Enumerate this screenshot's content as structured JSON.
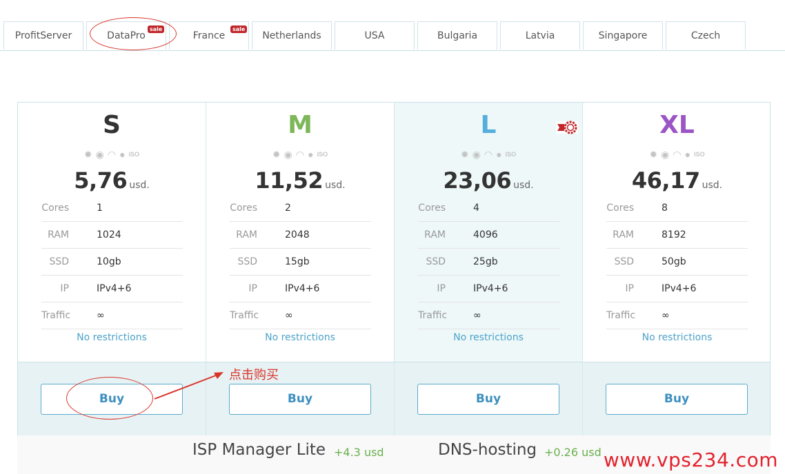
{
  "tabs": [
    {
      "label": "ProfitServer",
      "badge": ""
    },
    {
      "label": "DataPro",
      "badge": "sale"
    },
    {
      "label": "France",
      "badge": "sale"
    },
    {
      "label": "Netherlands",
      "badge": ""
    },
    {
      "label": "USA",
      "badge": ""
    },
    {
      "label": "Bulgaria",
      "badge": ""
    },
    {
      "label": "Latvia",
      "badge": ""
    },
    {
      "label": "Singapore",
      "badge": ""
    },
    {
      "label": "Czech",
      "badge": ""
    }
  ],
  "plans": [
    {
      "name": "S",
      "color": "#333333",
      "price": "5,76",
      "currency": "usd.",
      "cores": "1",
      "ram": "1024",
      "ssd": "10gb",
      "ip": "IPv4+6",
      "traffic": "∞",
      "note": "No restrictions",
      "buy": "Buy"
    },
    {
      "name": "M",
      "color": "#7db75a",
      "price": "11,52",
      "currency": "usd.",
      "cores": "2",
      "ram": "2048",
      "ssd": "15gb",
      "ip": "IPv4+6",
      "traffic": "∞",
      "note": "No restrictions",
      "buy": "Buy"
    },
    {
      "name": "L",
      "color": "#55aedb",
      "price": "23,06",
      "currency": "usd.",
      "cores": "4",
      "ram": "4096",
      "ssd": "25gb",
      "ip": "IPv4+6",
      "traffic": "∞",
      "note": "No restrictions",
      "buy": "Buy"
    },
    {
      "name": "XL",
      "color": "#9b55c5",
      "price": "46,17",
      "currency": "usd.",
      "cores": "8",
      "ram": "8192",
      "ssd": "50gb",
      "ip": "IPv4+6",
      "traffic": "∞",
      "note": "No restrictions",
      "buy": "Buy"
    }
  ],
  "spec_labels": {
    "cores": "Cores",
    "ram": "RAM",
    "ssd": "SSD",
    "ip": "IP",
    "traffic": "Traffic"
  },
  "os_icon_names": [
    "gear-icon",
    "ubuntu-icon",
    "debian-icon",
    "freebsd-icon",
    "iso-icon"
  ],
  "iso_label": "ISO",
  "addons": [
    {
      "name": "ISP Manager Lite",
      "price": "+4.3 usd"
    },
    {
      "name": "DNS-hosting",
      "price": "+0.26 usd"
    }
  ],
  "annotation_text": "点击购买",
  "watermark": "www.vps234.com",
  "colors": {
    "accent": "#3c8fbf",
    "annotation": "#d9342b",
    "sale": "#c0262a",
    "addon_price": "#6ab04c"
  }
}
